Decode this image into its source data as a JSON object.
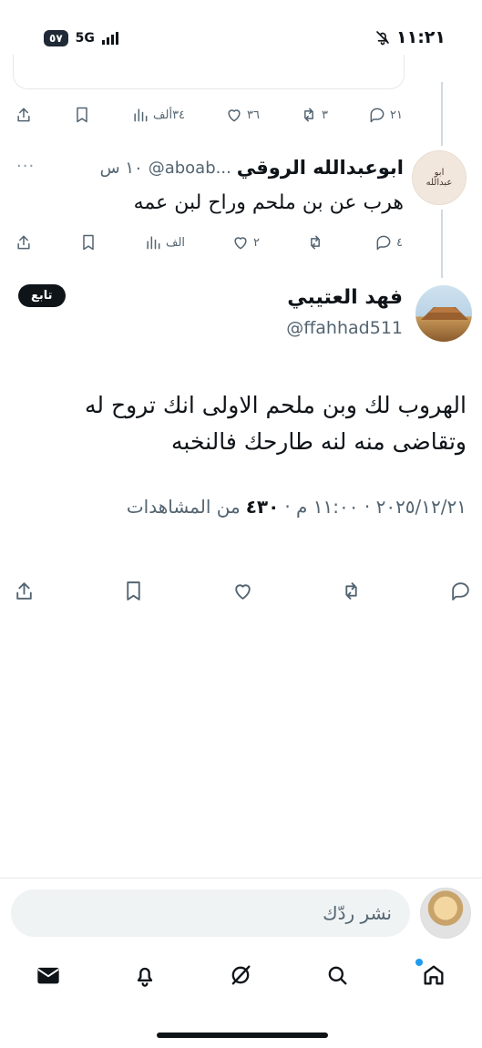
{
  "status_bar": {
    "time": "١١:٢١",
    "battery": "٥٧",
    "network": "5G"
  },
  "reply_tweet": {
    "author_name": "ابوعبدالله الروقي",
    "handle": "@aboab...",
    "time": "١٠ س",
    "text": "هرب عن بن ملحم وراح لبن عمه",
    "avatar_text_line1": "ابو",
    "avatar_text_line2": "عبدالله",
    "actions": {
      "replies": "٤",
      "retweets": "",
      "likes": "٢",
      "views": "الف"
    }
  },
  "previous_tweet_actions": {
    "replies": "٢١",
    "retweets": "٣",
    "likes": "٣٦",
    "views": "٣٤ألف"
  },
  "main_tweet": {
    "author_name": "فهد العتيبي",
    "handle": "@ffahhad511",
    "follow_label": "تابع",
    "text": "الهروب لك وبن ملحم الاولى انك تروح له وتقاضى منه لنه طارحك فالنخبه",
    "timestamp": "٢٠٢٥/١٢/٢١ · ١١:٠٠ م ·",
    "views_count": "٤٣٠",
    "views_label": "من المشاهدات"
  },
  "composer": {
    "placeholder": "نشر ردّك"
  },
  "tab_bar": [
    "home-icon",
    "search-icon",
    "grok-icon",
    "bell-icon",
    "mail-icon"
  ],
  "colors": {
    "text": "#0f1419",
    "muted": "#536471",
    "accent": "#1d9bf0",
    "input_bg": "#eff3f4"
  }
}
